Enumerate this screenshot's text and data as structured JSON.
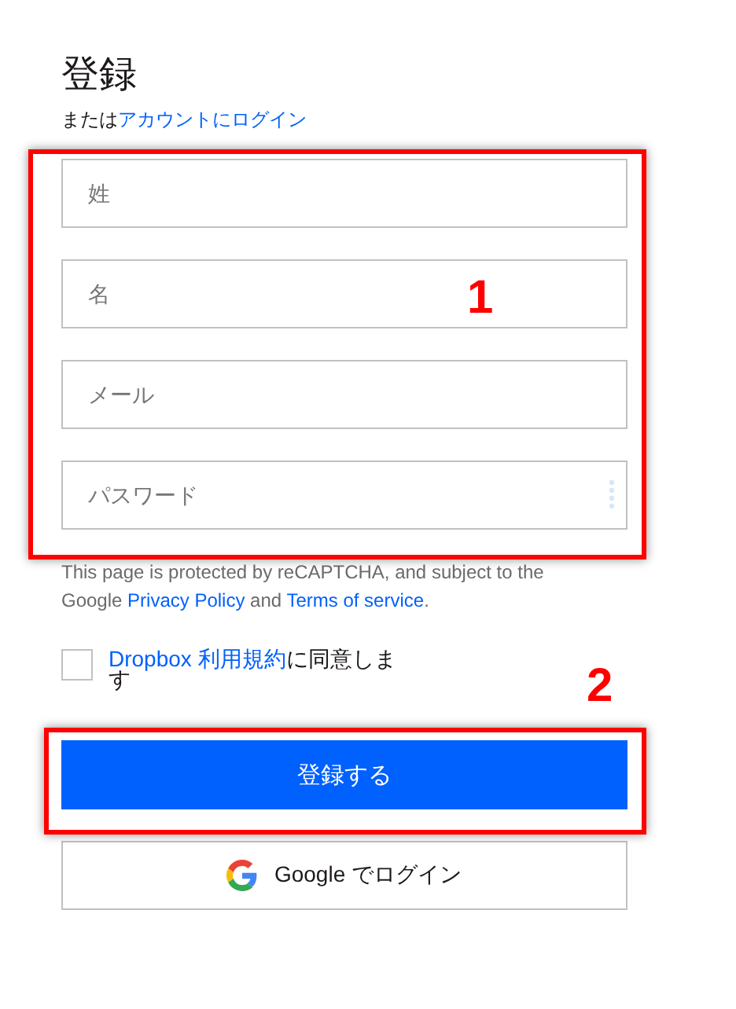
{
  "title": "登録",
  "subtitle": {
    "prefix": "または",
    "link": "アカウントにログイン"
  },
  "fields": [
    {
      "placeholder": "姓",
      "kind": "text"
    },
    {
      "placeholder": "名",
      "kind": "text"
    },
    {
      "placeholder": "メール",
      "kind": "text"
    },
    {
      "placeholder": "パスワード",
      "kind": "password"
    }
  ],
  "recaptcha_notice": [
    {
      "kind": "text",
      "text": "This page is protected by reCAPTCHA, and subject to the Google "
    },
    {
      "kind": "link",
      "text": "Privacy Policy"
    },
    {
      "kind": "text",
      "text": " and "
    },
    {
      "kind": "link",
      "text": "Terms of service"
    },
    {
      "kind": "text",
      "text": "."
    }
  ],
  "terms": {
    "checked": false,
    "link": "Dropbox 利用規約",
    "rest": "に同意します"
  },
  "submit_button": "登録する",
  "google_button": "Google でログイン",
  "fields_highlight": {
    "number": "1"
  },
  "submit_highlight": {
    "number": "2"
  }
}
